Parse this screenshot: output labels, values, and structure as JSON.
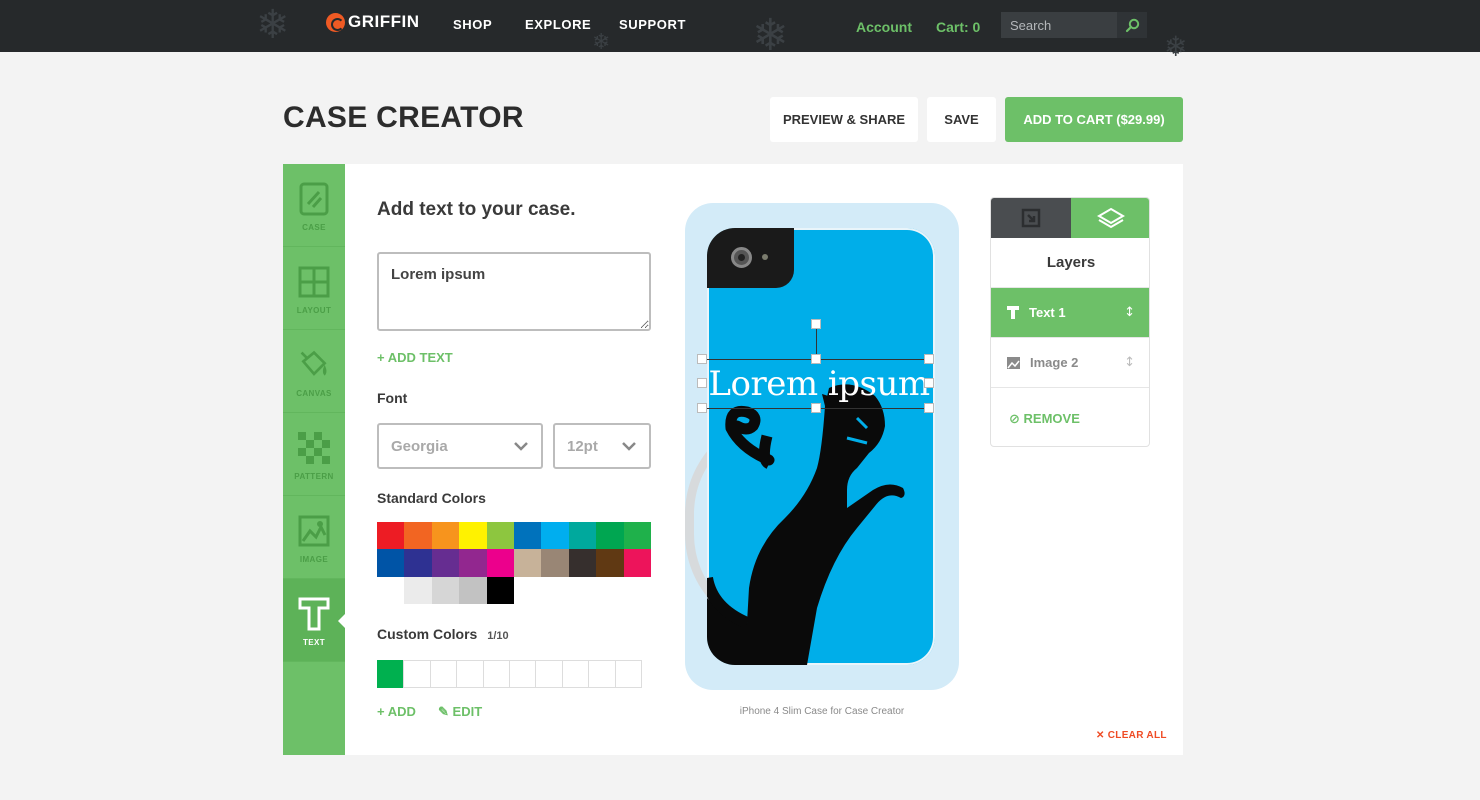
{
  "nav": {
    "brand": "GRIFFIN",
    "links": [
      "SHOP",
      "EXPLORE",
      "SUPPORT"
    ],
    "account": "Account",
    "cart": "Cart: 0",
    "search_placeholder": "Search"
  },
  "header": {
    "title": "CASE CREATOR",
    "preview_label": "PREVIEW & SHARE",
    "save_label": "SAVE",
    "add_to_cart_label": "ADD TO CART ($29.99)"
  },
  "sidebar": {
    "items": [
      {
        "label": "CASE",
        "icon": "case-icon"
      },
      {
        "label": "LAYOUT",
        "icon": "layout-icon"
      },
      {
        "label": "CANVAS",
        "icon": "paint-bucket-icon"
      },
      {
        "label": "PATTERN",
        "icon": "pattern-icon"
      },
      {
        "label": "IMAGE",
        "icon": "image-icon"
      },
      {
        "label": "TEXT",
        "icon": "text-icon",
        "active": true
      }
    ]
  },
  "editor": {
    "section_title": "Add text to your case.",
    "text_value": "Lorem ipsum",
    "add_text_label": "ADD TEXT",
    "font_label": "Font",
    "font_value": "Georgia",
    "size_value": "12pt",
    "standard_colors_label": "Standard Colors",
    "standard_colors": [
      "#ed1c24",
      "#f26522",
      "#f7941d",
      "#fff200",
      "#8dc63f",
      "#0072bc",
      "#00aeef",
      "#00a99d",
      "#00a651",
      "#1fb14b",
      "#0054a6",
      "#2e3192",
      "#662d91",
      "#92278f",
      "#ec008c",
      "#c7b299",
      "#998675",
      "#362f2d",
      "#603913",
      "#ed145b",
      "#ffffff",
      "#ebebeb",
      "#d6d6d6",
      "#c2c2c2",
      "#000000"
    ],
    "custom_colors_label": "Custom Colors",
    "custom_colors_count": "1/10",
    "custom_colors": [
      "#00b04f"
    ],
    "add_label": "ADD",
    "edit_label": "EDIT"
  },
  "preview": {
    "design_text": "Lorem ipsum",
    "case_color": "#00aee9",
    "caption": "iPhone 4 Slim Case for Case Creator"
  },
  "layers": {
    "title": "Layers",
    "items": [
      {
        "name": "Text 1",
        "icon": "text-layer-icon",
        "selected": true
      },
      {
        "name": "Image 2",
        "icon": "image-layer-icon",
        "selected": false
      }
    ],
    "remove_label": "REMOVE"
  },
  "clear_all_label": "CLEAR ALL",
  "colors": {
    "accent": "#6dc068",
    "nav_bg": "#26292b",
    "danger": "#ef4b24"
  }
}
